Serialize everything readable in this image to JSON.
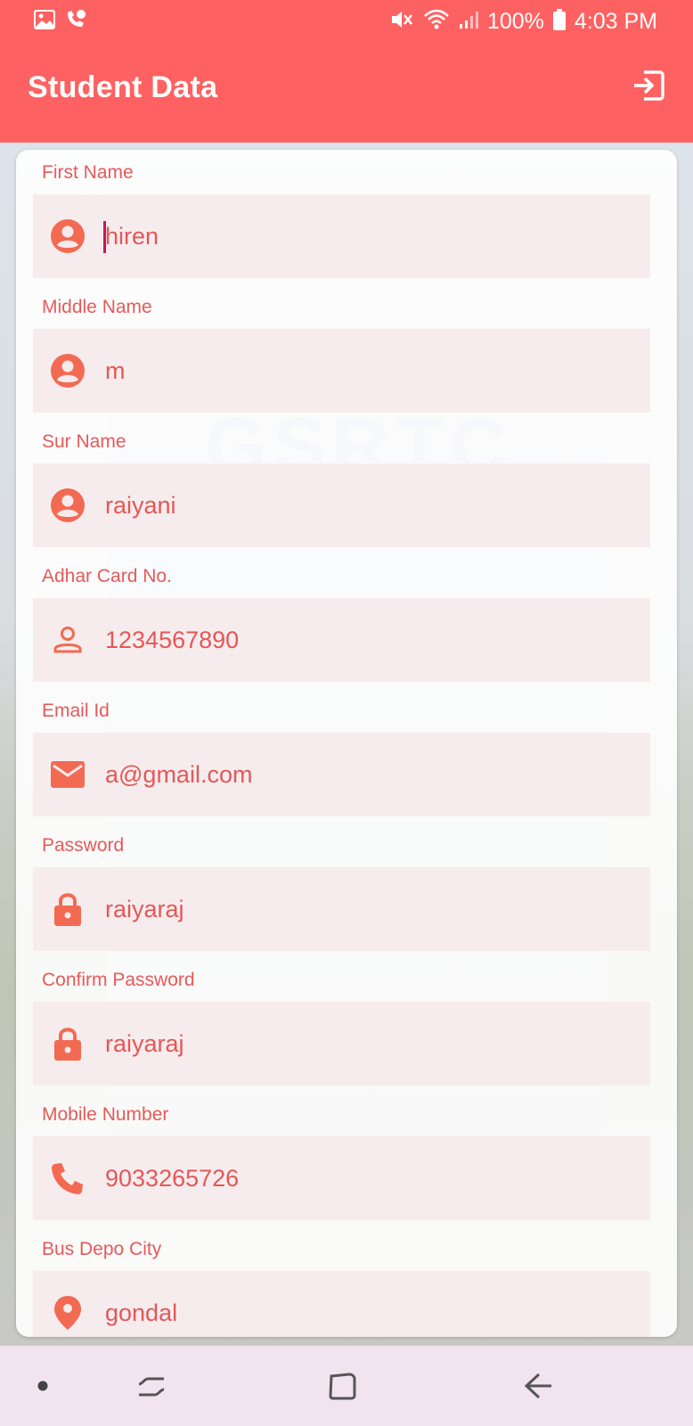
{
  "status_bar": {
    "battery": "100%",
    "time": "4:03 PM"
  },
  "app_bar": {
    "title": "Student Data"
  },
  "form": {
    "fields": [
      {
        "label": "First Name",
        "value": "hiren",
        "icon": "account-circle-icon",
        "focused": true
      },
      {
        "label": "Middle Name",
        "value": "m",
        "icon": "account-circle-icon"
      },
      {
        "label": "Sur Name",
        "value": "raiyani",
        "icon": "account-circle-icon"
      },
      {
        "label": "Adhar Card No.",
        "value": "1234567890",
        "icon": "person-outline-icon"
      },
      {
        "label": "Email Id",
        "value": "a@gmail.com",
        "icon": "email-icon"
      },
      {
        "label": "Password",
        "value": "raiyaraj",
        "icon": "lock-icon"
      },
      {
        "label": "Confirm Password",
        "value": "raiyaraj",
        "icon": "lock-icon"
      },
      {
        "label": "Mobile Number",
        "value": "9033265726",
        "icon": "phone-icon"
      },
      {
        "label": "Bus Depo City",
        "value": "gondal",
        "icon": "location-pin-icon"
      }
    ]
  },
  "colors": {
    "accent": "#fe6161",
    "label": "#e65a5a",
    "icon": "#f36a52",
    "field_bg": "#f6eaec",
    "nav_bg": "#f1e4ef"
  }
}
